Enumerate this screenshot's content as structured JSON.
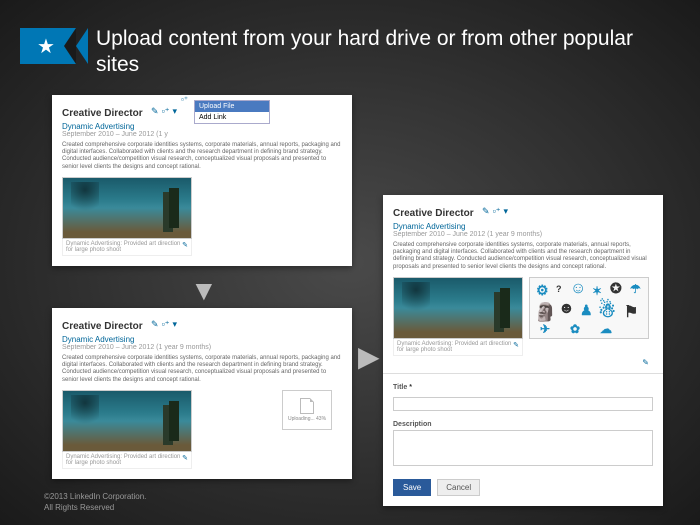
{
  "headline": "Upload content from your hard drive or from other popular sites",
  "job": {
    "title": "Creative Director",
    "company": "Dynamic Advertising",
    "dates": "September 2010 – June 2012 (1 year 9 months)",
    "dates_short": "September 2010 – June 2012 (1 y",
    "blurb": "Created comprehensive corporate identities systems, corporate materials, annual reports, packaging and digital interfaces. Collaborated with clients and the research department in defining brand strategy. Conducted audience/competition visual research, conceptualized visual proposals and presented to senior level clients the designs and concept rational.",
    "caption": "Dynamic Advertising: Provided art direction for large photo shoot"
  },
  "dropdown": {
    "upload": "Upload File",
    "link": "Add Link"
  },
  "uploading": {
    "label": "Uploading... 43%"
  },
  "form": {
    "title_label": "Title",
    "required": "*",
    "desc_label": "Description",
    "save": "Save",
    "cancel": "Cancel"
  },
  "footer": {
    "line1": "©2013 LinkedIn Corporation.",
    "line2": "All Rights Reserved"
  }
}
